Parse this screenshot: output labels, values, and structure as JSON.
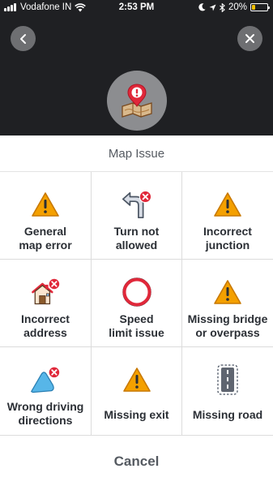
{
  "status_bar": {
    "carrier": "Vodafone IN",
    "time": "2:53 PM",
    "battery": "20%",
    "battery_level": 0.2
  },
  "header": {
    "back_icon": "chevron-left-icon",
    "close_icon": "close-icon",
    "hero_icon": "map-with-warning-pin-icon"
  },
  "sheet": {
    "title": "Map Issue",
    "cancel_label": "Cancel",
    "options": [
      {
        "line1": "General",
        "line2": "map error",
        "icon": "warning-triangle-icon"
      },
      {
        "line1": "Turn not",
        "line2": "allowed",
        "icon": "turn-not-allowed-icon"
      },
      {
        "line1": "Incorrect",
        "line2": "junction",
        "icon": "warning-triangle-icon"
      },
      {
        "line1": "Incorrect",
        "line2": "address",
        "icon": "house-x-icon"
      },
      {
        "line1": "Speed",
        "line2": "limit issue",
        "icon": "speed-limit-icon"
      },
      {
        "line1": "Missing bridge",
        "line2": "or overpass",
        "icon": "warning-triangle-icon"
      },
      {
        "line1": "Wrong driving",
        "line2": "directions",
        "icon": "wrong-directions-icon"
      },
      {
        "line1": "Missing exit",
        "line2": "",
        "icon": "warning-triangle-icon"
      },
      {
        "line1": "Missing road",
        "line2": "",
        "icon": "road-icon"
      }
    ]
  },
  "colors": {
    "warning_orange": "#f4a000",
    "alert_red": "#e0283a",
    "dark_header": "#1f2023",
    "text_dark": "#2b2f35"
  }
}
